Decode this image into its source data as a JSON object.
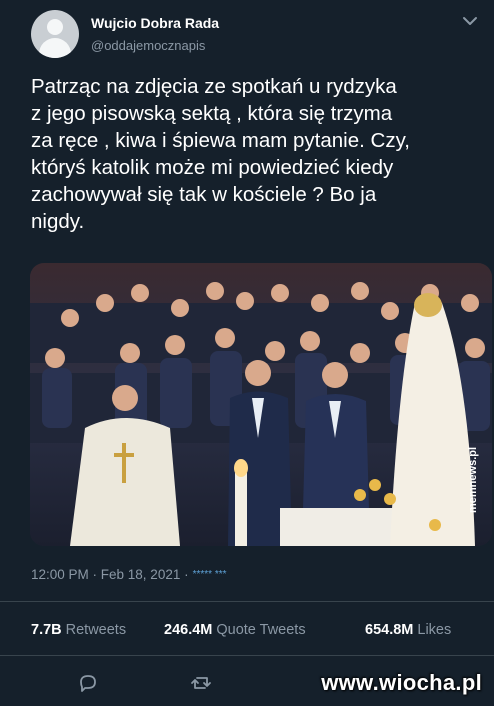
{
  "tweet": {
    "author_name": "Wujcio Dobra Rada",
    "author_handle": "@oddajemocznapis",
    "text": "Patrząc na zdjęcia ze spotkań u rydzyka\nz jego pisowską sektą , która się trzyma\nza ręce , kiwa i śpiewa mam pytanie. Czy,\nktóryś katolik może mi powiedzieć kiedy\nzachowywał się tak w kościele ? Bo ja\nnigdy.",
    "time": "12:00 PM · Feb 18, 2021 ·",
    "client_dots": "*****  ***",
    "photo_watermark": "mem\nnews.pl",
    "stats": {
      "retweets_value": "7.7B",
      "retweets_label": "Retweets",
      "quote_value": "246.4M",
      "quote_label": "Quote Tweets",
      "likes_value": "654.8M",
      "likes_label": "Likes"
    },
    "actions": [
      "reply-icon",
      "retweet-icon",
      "like-icon",
      "share-icon"
    ]
  },
  "site_watermark": "www.wiocha.pl",
  "colors": {
    "background": "#15202b",
    "text": "#ffffff",
    "secondary": "#8b98a5",
    "divider": "#38444d"
  }
}
